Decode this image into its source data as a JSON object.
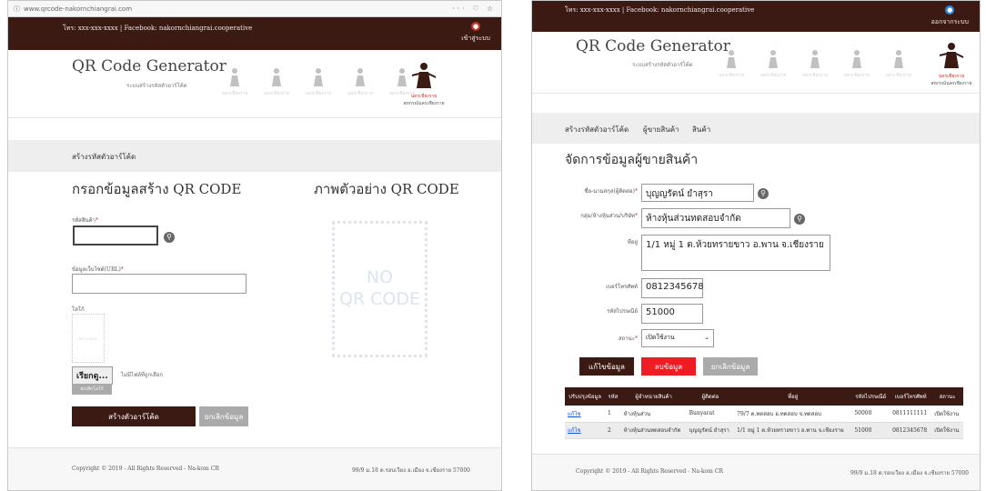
{
  "left_screen": {
    "browser": {
      "url": "www.qrcode-nakornchiangrai.com",
      "tools": "··· ♡ ☆"
    },
    "topbar": {
      "contact": "โทร: xxx-xxx-xxxx | Facebook: nakornchiangrai.cooperative",
      "user_label": "เข้าสู่ระบบ"
    },
    "header": {
      "title": "QR Code Generator",
      "subtitle": "ระบบสร้างรหัสตัวอาร์โค้ด",
      "logo_text": "นครเชียงราย",
      "logo_caption": "สหกรณ์นครเชียงราย"
    },
    "nav": {
      "item": "สร้างรหัสตัวอาร์โค้ด"
    },
    "form": {
      "heading": "กรอกข้อมูลสร้าง QR CODE",
      "code_label": "รหัสสินค้า",
      "url_label": "ข้อมูลเว็บไซต์(URL)",
      "logo_label": "โลโก้",
      "logo_placeholder": "NO LOGO",
      "browse_label": "เรียกดู...",
      "browse_status": "ไม่มีไฟล์ที่ถูกเลือก",
      "clear_logo_label": "ยกเลิกโลโก้",
      "create_label": "สร้างตัวอาร์โค้ด",
      "cancel_label": "ยกเลิกข้อมูล"
    },
    "preview": {
      "heading": "ภาพตัวอย่าง QR CODE",
      "line1": "NO",
      "line2": "QR CODE"
    },
    "footer": {
      "copyright": "Copyright © 2019 - All Rights Reserved - Na-kom CR",
      "address": "99/9 ม.18 ต.รอบเวียง อ.เมือง จ.เชียงราย 57000"
    }
  },
  "right_screen": {
    "topbar": {
      "contact": "โทร: xxx-xxx-xxxx | Facebook: nakornchiangrai.cooperative",
      "user_label": "ออกจากระบบ"
    },
    "header": {
      "title": "QR Code Generator",
      "subtitle": "ระบบสร้างรหัสตัวอาร์โค้ด",
      "logo_text": "นครเชียงราย",
      "logo_caption": "สหกรณ์นครเชียงราย"
    },
    "nav": {
      "items": [
        "สร้างรหัสตัวอาร์โค้ด",
        "ผู้ขายสินค้า",
        "สินค้า"
      ]
    },
    "form": {
      "heading": "จัดการข้อมูลผู้ขายสินค้า",
      "name_label": "ชื่อ-นามสกุล(ผู้ติดต่อ)",
      "name_value": "บุญญรัตน์ ยำสุรา",
      "group_label": "กลุ่ม/ห้างหุ้นส่วน/บริษัท",
      "group_value": "ห้างหุ้นส่วนทดสอบจำกัด",
      "address_label": "ที่อยู่",
      "address_value": "1/1 หมู่ 1 ต.ห้วยทรายขาว อ.พาน จ.เชียงราย",
      "phone_label": "เบอร์โทรศัพท์",
      "phone_value": "0812345678",
      "zip_label": "รหัสไปรษณีย์",
      "zip_value": "51000",
      "status_label": "สถานะ",
      "status_value": "เปิดใช้งาน",
      "edit_label": "แก้ไขข้อมูล",
      "delete_label": "ลบข้อมูล",
      "cancel_label": "ยกเลิกข้อมูล"
    },
    "table": {
      "headers": [
        "ปรับปรุงข้อมูล",
        "รหัส",
        "ผู้จำหน่ายสินค้า",
        "ผู้ติดต่อ",
        "ที่อยู่",
        "รหัสไปรษณีย์",
        "เบอร์โทรศัพท์",
        "สถานะ"
      ],
      "rows": [
        [
          "แก้ไข",
          "1",
          "ห้างหุ้นส่วน",
          "Bunyarat",
          "79/7 ต.ทดสอบ อ.ทดสอบ จ.ทดสอบ",
          "50000",
          "0811111111",
          "เปิดใช้งาน"
        ],
        [
          "แก้ไข",
          "2",
          "ห้างหุ้นส่วนทดสอบจำกัด",
          "บุญญรัตน์ ยำสุรา",
          "1/1 หมู่ 1 ต.ห้วยทรายขาว อ.พาน จ.เชียงราย",
          "51000",
          "0812345678",
          "เปิดใช้งาน"
        ]
      ]
    },
    "footer": {
      "copyright": "Copyright © 2019 - All Rights Reserved - Na-kom CR",
      "address": "99/9 ม.18 ต.รอบเวียง อ.เมือง จ.เชียงราย 57000"
    }
  },
  "colors": {
    "brand_dark": "#3b1a14",
    "danger": "#ee1d23",
    "neutral_button": "#aaaaaa",
    "link": "#1a4fcf"
  }
}
